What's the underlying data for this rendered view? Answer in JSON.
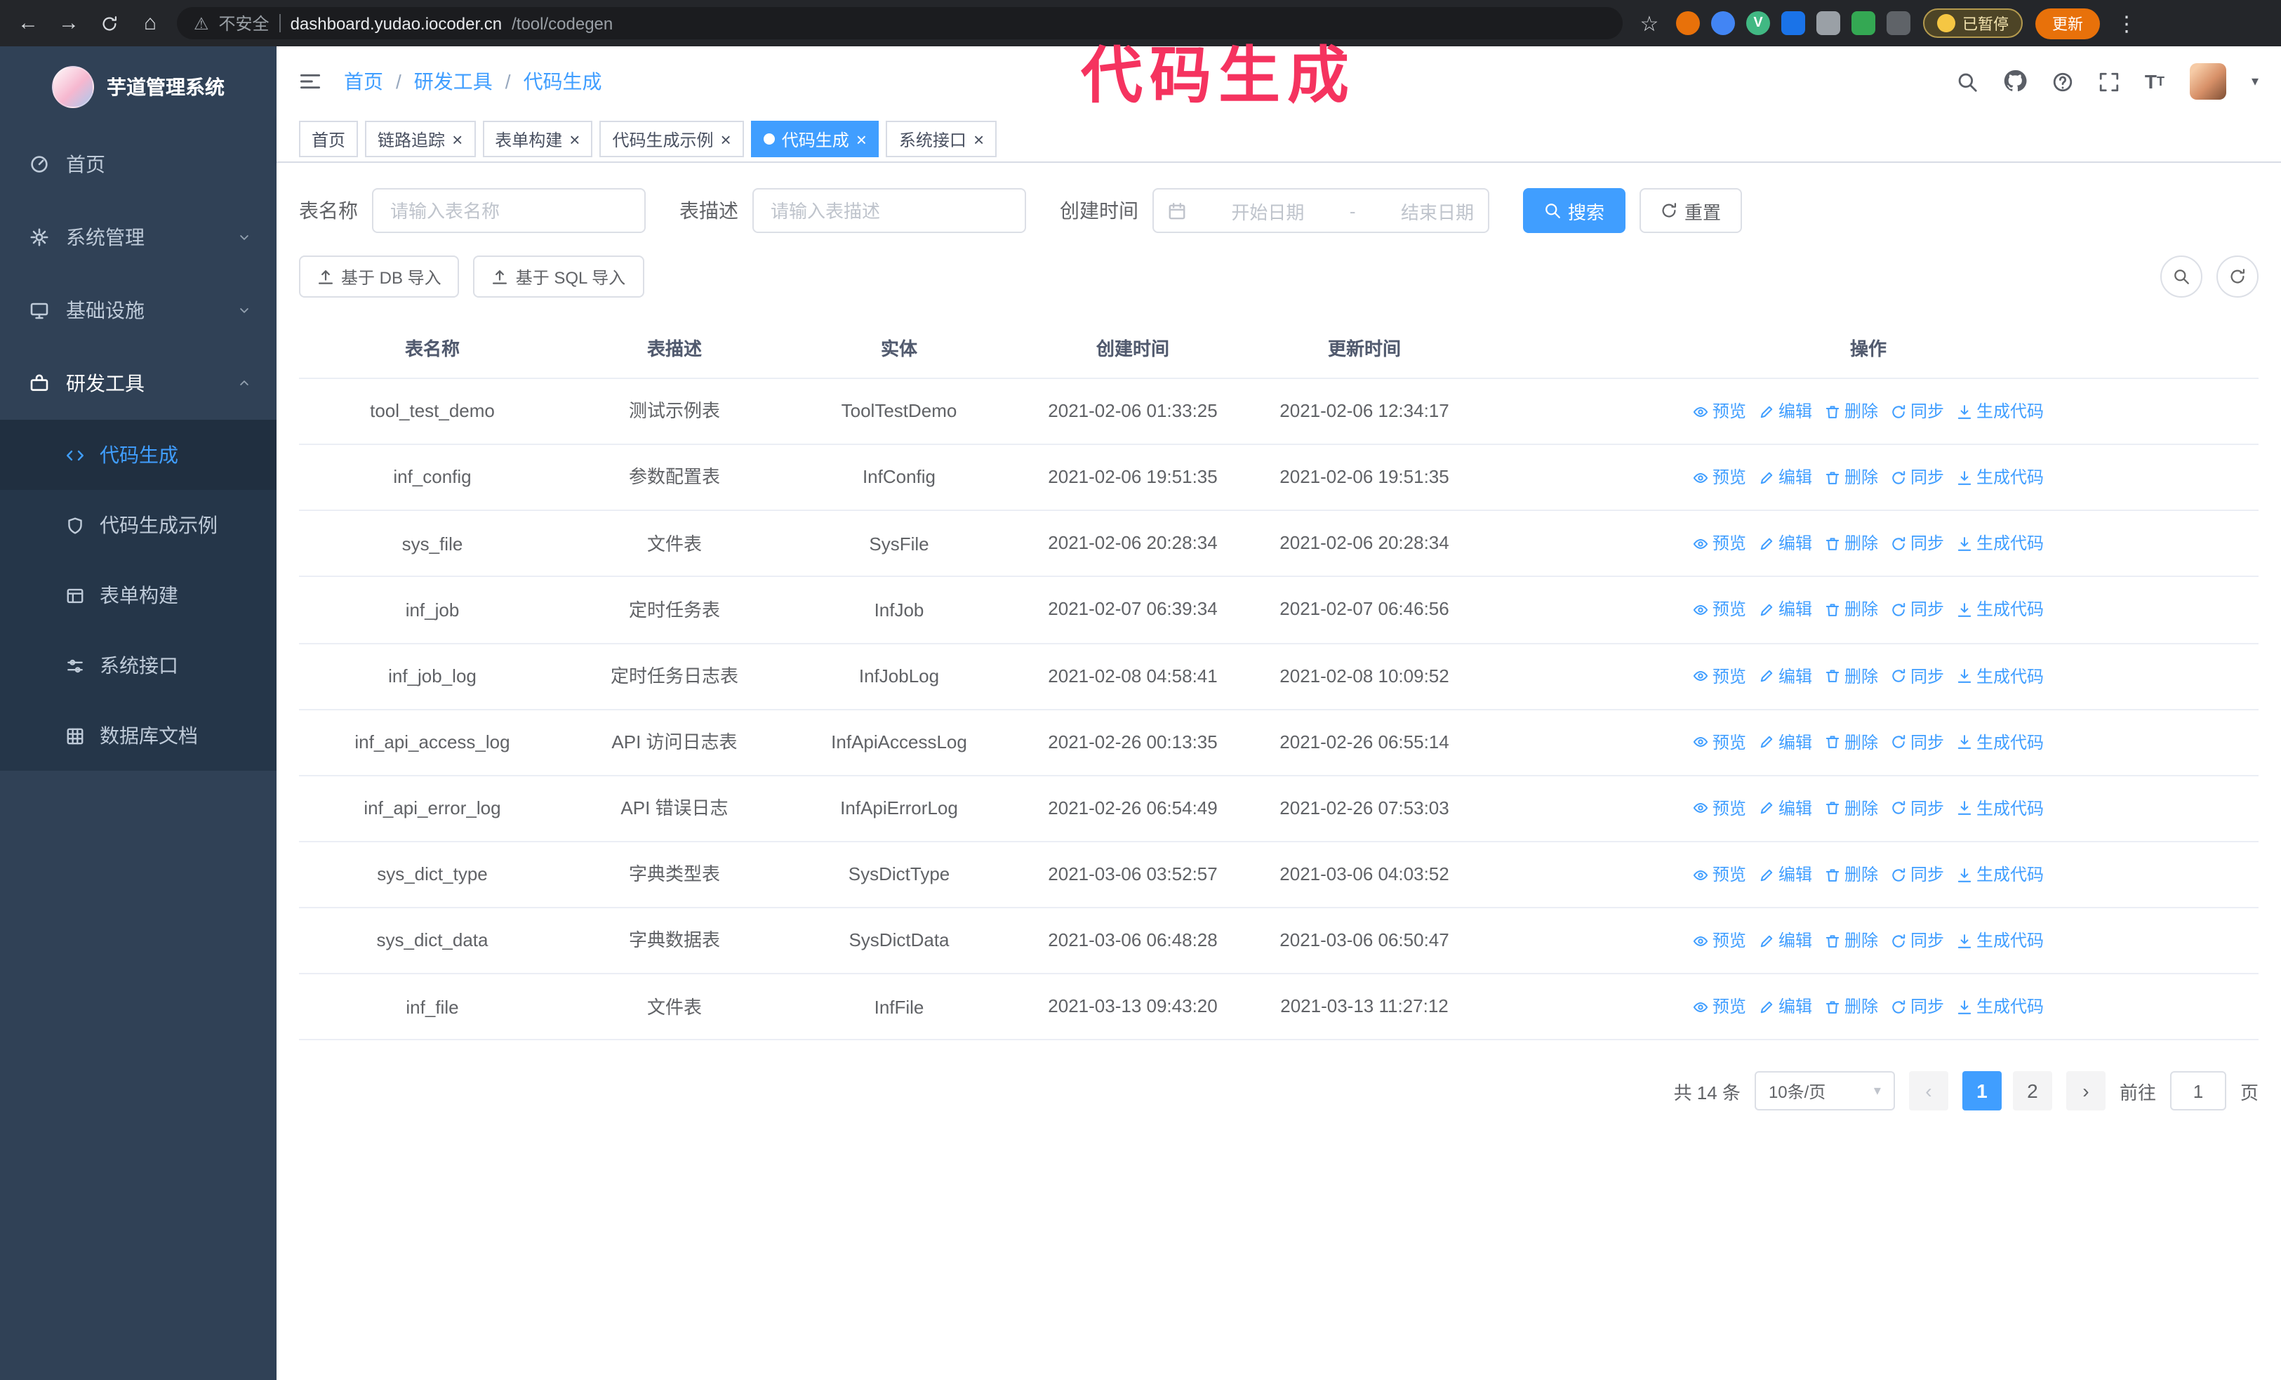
{
  "annotation": {
    "text": "代码生成",
    "color": "#f5335f"
  },
  "theme": {
    "accent": "#409eff",
    "sidebar_bg": "#304156",
    "submenu_bg": "#253649"
  },
  "icons": {
    "back": "←",
    "forward": "→",
    "home": "⌂",
    "star": "☆",
    "warning": "⚠",
    "kebab": "⋮",
    "caret": "▾",
    "close": "×",
    "prev": "‹",
    "next": "›"
  },
  "browser": {
    "security_label": "不安全",
    "url_host": "dashboard.yudao.iocoder.cn",
    "url_path": "/tool/codegen",
    "paused_label": "已暂停",
    "update_label": "更新",
    "extensions": [
      {
        "name": "extension-orange-icon",
        "color": "#e8710a",
        "shape": "circle",
        "glyph": ""
      },
      {
        "name": "extension-blue-icon",
        "color": "#4285f4",
        "shape": "circle",
        "glyph": ""
      },
      {
        "name": "vue-devtools-icon",
        "color": "#41b883",
        "shape": "circle",
        "glyph": "V"
      },
      {
        "name": "extension-people-icon",
        "color": "#1a73e8",
        "shape": "square",
        "glyph": ""
      },
      {
        "name": "extension-grey-icon",
        "color": "#9aa0a6",
        "shape": "square",
        "glyph": ""
      },
      {
        "name": "extension-green-icon",
        "color": "#34a853",
        "shape": "square",
        "glyph": ""
      },
      {
        "name": "extension-puzzle-icon",
        "color": "#5f6368",
        "shape": "square",
        "glyph": ""
      }
    ]
  },
  "sidebar": {
    "logo_title": "芋道管理系统",
    "items": [
      {
        "key": "home",
        "label": "首页",
        "icon": "home"
      },
      {
        "key": "system",
        "label": "系统管理",
        "icon": "gear",
        "chevron": "down"
      },
      {
        "key": "infra",
        "label": "基础设施",
        "icon": "infra",
        "chevron": "down"
      },
      {
        "key": "devtools",
        "label": "研发工具",
        "icon": "tools",
        "chevron": "up",
        "expanded": true
      }
    ],
    "subitems": [
      {
        "key": "codegen",
        "label": "代码生成",
        "icon": "code",
        "active": true
      },
      {
        "key": "codegen-demo",
        "label": "代码生成示例",
        "icon": "badge"
      },
      {
        "key": "form-builder",
        "label": "表单构建",
        "icon": "form"
      },
      {
        "key": "system-api",
        "label": "系统接口",
        "icon": "api"
      },
      {
        "key": "db-doc",
        "label": "数据库文档",
        "icon": "db"
      }
    ]
  },
  "header": {
    "breadcrumb": [
      "首页",
      "研发工具",
      "代码生成"
    ],
    "icons": [
      {
        "name": "search-icon",
        "icon": "magnifier"
      },
      {
        "name": "github-icon",
        "icon": "github"
      },
      {
        "name": "help-icon",
        "icon": "question"
      },
      {
        "name": "fullscreen-icon",
        "icon": "fullscreen"
      },
      {
        "name": "font-size-icon",
        "icon": "fontsize"
      }
    ]
  },
  "tabs": [
    {
      "key": "home",
      "label": "首页",
      "closable": false,
      "active": false
    },
    {
      "key": "trace",
      "label": "链路追踪",
      "closable": true,
      "active": false
    },
    {
      "key": "form-builder",
      "label": "表单构建",
      "closable": true,
      "active": false
    },
    {
      "key": "codegen-demo",
      "label": "代码生成示例",
      "closable": true,
      "active": false
    },
    {
      "key": "codegen",
      "label": "代码生成",
      "closable": true,
      "active": true
    },
    {
      "key": "system-api",
      "label": "系统接口",
      "closable": true,
      "active": false
    }
  ],
  "filters": {
    "name_label": "表名称",
    "name_placeholder": "请输入表名称",
    "desc_label": "表描述",
    "desc_placeholder": "请输入表描述",
    "time_label": "创建时间",
    "start_placeholder": "开始日期",
    "range_separator": "-",
    "end_placeholder": "结束日期",
    "search_label": "搜索",
    "reset_label": "重置"
  },
  "toolbar": {
    "import_db_label": "基于 DB 导入",
    "import_sql_label": "基于 SQL 导入"
  },
  "table": {
    "columns": [
      "表名称",
      "表描述",
      "实体",
      "创建时间",
      "更新时间",
      "操作"
    ],
    "actions": [
      {
        "name": "preview",
        "label": "预览",
        "icon": "eye"
      },
      {
        "name": "edit",
        "label": "编辑",
        "icon": "edit"
      },
      {
        "name": "delete",
        "label": "删除",
        "icon": "del"
      },
      {
        "name": "sync",
        "label": "同步",
        "icon": "sync"
      },
      {
        "name": "generate-code",
        "label": "生成代码",
        "icon": "download"
      }
    ],
    "rows": [
      {
        "name": "tool_test_demo",
        "description": "测试示例表",
        "entity": "ToolTestDemo",
        "created": "2021-02-06 01:33:25",
        "updated": "2021-02-06 12:34:17"
      },
      {
        "name": "inf_config",
        "description": "参数配置表",
        "entity": "InfConfig",
        "created": "2021-02-06 19:51:35",
        "updated": "2021-02-06 19:51:35"
      },
      {
        "name": "sys_file",
        "description": "文件表",
        "entity": "SysFile",
        "created": "2021-02-06 20:28:34",
        "updated": "2021-02-06 20:28:34"
      },
      {
        "name": "inf_job",
        "description": "定时任务表",
        "entity": "InfJob",
        "created": "2021-02-07 06:39:34",
        "updated": "2021-02-07 06:46:56"
      },
      {
        "name": "inf_job_log",
        "description": "定时任务日志表",
        "entity": "InfJobLog",
        "created": "2021-02-08 04:58:41",
        "updated": "2021-02-08 10:09:52"
      },
      {
        "name": "inf_api_access_log",
        "description": "API 访问日志表",
        "entity": "InfApiAccessLog",
        "created": "2021-02-26 00:13:35",
        "updated": "2021-02-26 06:55:14"
      },
      {
        "name": "inf_api_error_log",
        "description": "API 错误日志",
        "entity": "InfApiErrorLog",
        "created": "2021-02-26 06:54:49",
        "updated": "2021-02-26 07:53:03"
      },
      {
        "name": "sys_dict_type",
        "description": "字典类型表",
        "entity": "SysDictType",
        "created": "2021-03-06 03:52:57",
        "updated": "2021-03-06 04:03:52"
      },
      {
        "name": "sys_dict_data",
        "description": "字典数据表",
        "entity": "SysDictData",
        "created": "2021-03-06 06:48:28",
        "updated": "2021-03-06 06:50:47"
      },
      {
        "name": "inf_file",
        "description": "文件表",
        "entity": "InfFile",
        "created": "2021-03-13 09:43:20",
        "updated": "2021-03-13 11:27:12"
      }
    ]
  },
  "pagination": {
    "total": "共 14 条",
    "page_size": "10条/页",
    "pages": [
      "1",
      "2"
    ],
    "active_page": "1",
    "goto_label": "前往",
    "goto_value": "1",
    "page_label": "页"
  }
}
